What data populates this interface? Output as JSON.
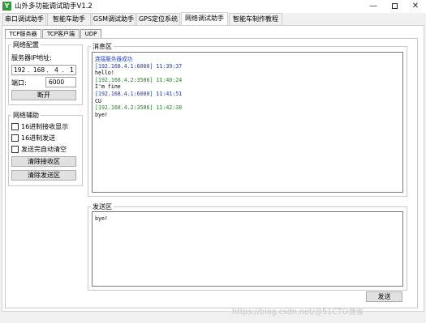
{
  "window": {
    "title": "山外多功能调试助手V1.2",
    "icon_text": "Y",
    "controls": {
      "minimize": "—",
      "maximize": "max-icon",
      "close": "✕"
    }
  },
  "main_tabs": [
    {
      "label": "串口调试助手",
      "active": false
    },
    {
      "label": "智能车助手",
      "active": false
    },
    {
      "label": "GSM调试助手",
      "active": false
    },
    {
      "label": "GPS定位系统",
      "active": false
    },
    {
      "label": "网络调试助手",
      "active": true
    },
    {
      "label": "智能车制作教程",
      "active": false
    }
  ],
  "sub_tabs": [
    {
      "label": "TCP服务器",
      "active": true
    },
    {
      "label": "TCP客户端",
      "active": false
    },
    {
      "label": "UDP",
      "active": false
    }
  ],
  "network_config": {
    "title": "网络配置",
    "server_ip_label": "服务器IP地址:",
    "server_ip": "192 .  168 .   4  .   1",
    "port_label": "端口:",
    "port": "6000",
    "disconnect_button": "断开"
  },
  "network_assist": {
    "title": "网络辅助",
    "options": [
      {
        "label": "16进制接收显示",
        "checked": false
      },
      {
        "label": "16进制发送",
        "checked": false
      },
      {
        "label": "发送完自动清空",
        "checked": false
      }
    ],
    "clear_receive_button": "清除接收区",
    "clear_send_button": "清除发送区"
  },
  "message_area": {
    "title": "消息区",
    "lines": [
      {
        "text": "连接服务器成功",
        "color": "blue"
      },
      {
        "text": "[192.168.4.1:6000] 11:39:37",
        "color": "blue"
      },
      {
        "text": "hello!",
        "color": "black"
      },
      {
        "text": "[192.168.4.2:3586] 11:40:24",
        "color": "green"
      },
      {
        "text": "I'm fine",
        "color": "black"
      },
      {
        "text": "[192.168.4.1:6000] 11:41:51",
        "color": "blue"
      },
      {
        "text": "CU",
        "color": "black"
      },
      {
        "text": "[192.168.4.2:3586] 11:42:38",
        "color": "green"
      },
      {
        "text": "bye!",
        "color": "black"
      }
    ]
  },
  "send_area": {
    "title": "发送区",
    "content": "bye!",
    "send_button": "发送"
  },
  "watermark": "https://blog.csdn.net/@51CTO博客",
  "colors": {
    "accent_blue": "#1a3cc8",
    "accent_green": "#1d8a1d",
    "icon_green": "#2e9b3a"
  }
}
